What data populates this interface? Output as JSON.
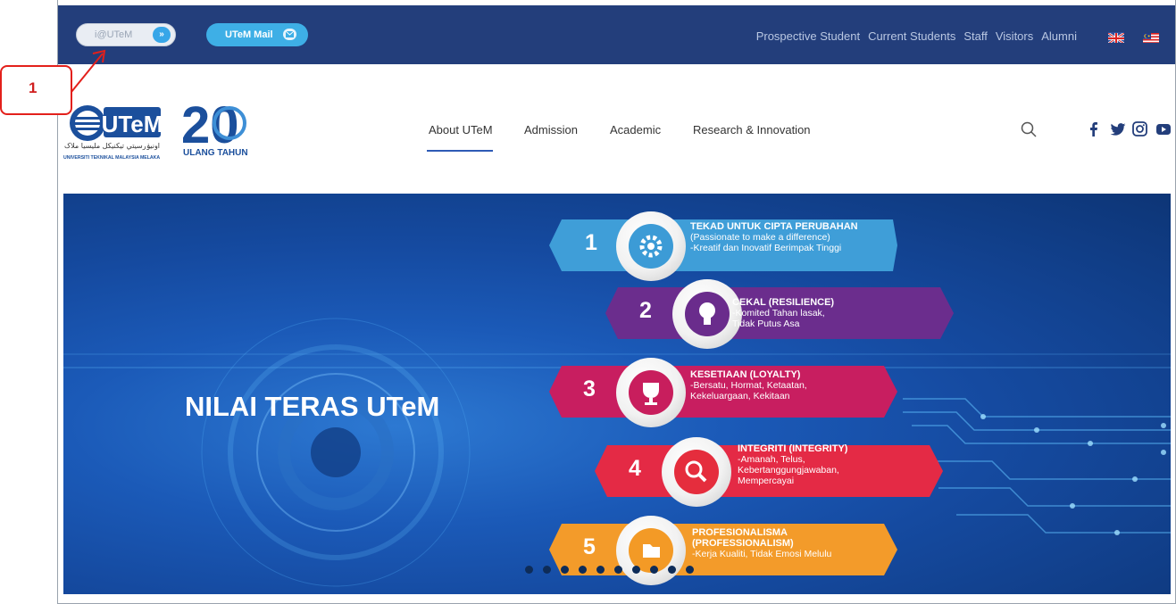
{
  "topbar": {
    "iutem_label": "i@UTeM",
    "iutem_button": "»",
    "mail_label": "UTeM Mail",
    "links": [
      "Prospective Student",
      "Current Students",
      "Staff",
      "Visitors",
      "Alumni"
    ],
    "languages": [
      "uk-flag-icon",
      "malaysia-flag-icon"
    ]
  },
  "callout": {
    "number": "1"
  },
  "logos": {
    "utem_wordmark": "UTeM",
    "utem_jawi": "اونيۏرسيتي تيکنيکل مليسيا ملاک",
    "utem_caption": "UNIVERSITI TEKNIKAL MALAYSIA MELAKA",
    "anniversary_number": "20",
    "anniversary_caption": "ULANG TAHUN"
  },
  "mainnav": {
    "items": [
      "About UTeM",
      "Admission",
      "Academic",
      "Research & Innovation"
    ],
    "active": "About UTeM",
    "search_icon": "search-icon",
    "social": [
      "facebook-icon",
      "twitter-icon",
      "instagram-icon",
      "youtube-icon"
    ]
  },
  "banner": {
    "title": "NILAI TERAS UTeM",
    "values": [
      {
        "number": "1",
        "heading": "TEKAD UNTUK CIPTA PERUBAHAN",
        "lines": [
          "(Passionate to make a difference)",
          "-Kreatif dan Inovatif Berimpak Tinggi"
        ],
        "icon": "gear-icon",
        "color": "#3c9bd6"
      },
      {
        "number": "2",
        "heading": "CEKAL (RESILIENCE)",
        "lines": [
          "-Komited Tahan lasak,",
          "Tidak Putus Asa"
        ],
        "icon": "lightbulb-icon",
        "color": "#6a2c8c"
      },
      {
        "number": "3",
        "heading": "KESETIAAN (LOYALTY)",
        "lines": [
          "-Bersatu, Hormat, Ketaatan,",
          "Kekeluargaan, Kekitaan"
        ],
        "icon": "trophy-icon",
        "color": "#c81e5d"
      },
      {
        "number": "4",
        "heading": "INTEGRITI (INTEGRITY)",
        "lines": [
          "-Amanah, Telus,",
          "Kebertanggungjawaban,",
          "Mempercayai"
        ],
        "icon": "magnifier-icon",
        "color": "#e52d3d"
      },
      {
        "number": "5",
        "heading": "PROFESIONALISMA",
        "lines": [
          "(PROFESSIONALISM)",
          "-Kerja Kualiti, Tidak Emosi Melulu"
        ],
        "icon": "folder-icon",
        "color": "#f39a26"
      }
    ],
    "slide_count": 10
  }
}
